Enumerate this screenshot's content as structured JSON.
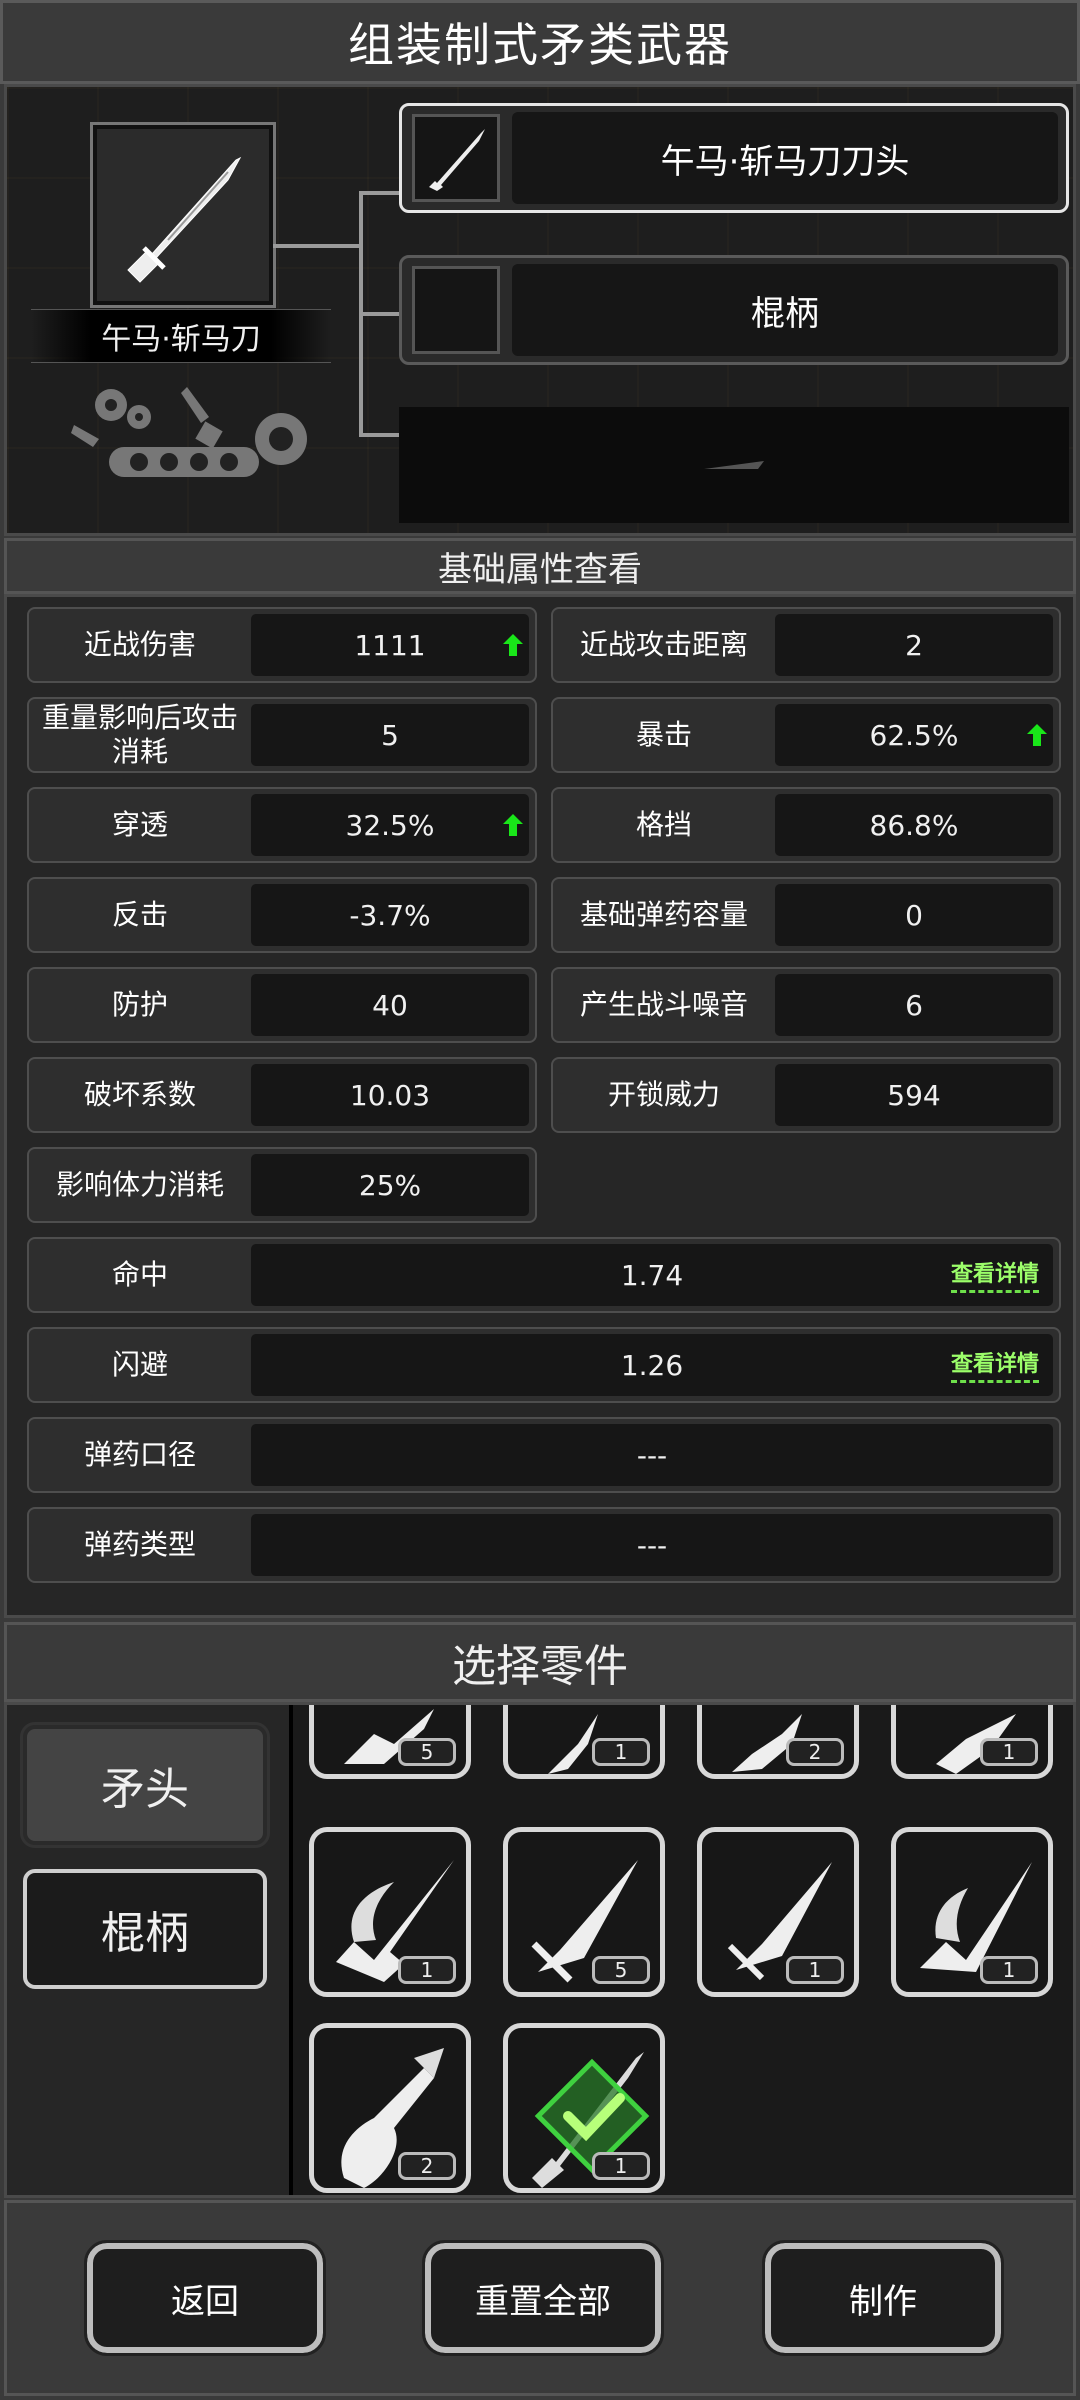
{
  "header": {
    "title": "组装制式矛类武器"
  },
  "assembly": {
    "weapon_name": "午马·斩马刀",
    "weapon_icon": "saber-icon",
    "parts": [
      {
        "label": "午马·斩马刀刀头",
        "icon": "blade-icon",
        "active": true
      },
      {
        "label": "棍柄",
        "icon": "",
        "active": false
      },
      {
        "label": "",
        "icon": "",
        "locked": true
      }
    ]
  },
  "attributes": {
    "title": "基础属性查看",
    "stats": [
      {
        "label": "近战伤害",
        "value": "1111",
        "up": true
      },
      {
        "label": "近战攻击距离",
        "value": "2",
        "up": false
      },
      {
        "label": "重量影响后攻击消耗",
        "value": "5",
        "up": false
      },
      {
        "label": "暴击",
        "value": "62.5%",
        "up": true
      },
      {
        "label": "穿透",
        "value": "32.5%",
        "up": true
      },
      {
        "label": "格挡",
        "value": "86.8%",
        "up": false
      },
      {
        "label": "反击",
        "value": "-3.7%",
        "up": false
      },
      {
        "label": "基础弹药容量",
        "value": "0",
        "up": false
      },
      {
        "label": "防护",
        "value": "40",
        "up": false
      },
      {
        "label": "产生战斗噪音",
        "value": "6",
        "up": false
      },
      {
        "label": "破坏系数",
        "value": "10.03",
        "up": false
      },
      {
        "label": "开锁威力",
        "value": "594",
        "up": false
      },
      {
        "label": "影响体力消耗",
        "value": "25%",
        "up": false
      }
    ],
    "wide_stats": [
      {
        "label": "命中",
        "value": "1.74",
        "link": "查看详情"
      },
      {
        "label": "闪避",
        "value": "1.26",
        "link": "查看详情"
      },
      {
        "label": "弹药口径",
        "value": "---",
        "link": ""
      },
      {
        "label": "弹药类型",
        "value": "---",
        "link": ""
      }
    ],
    "up_color": "#19e619",
    "link_color": "#9cff6a"
  },
  "selection": {
    "title": "选择零件",
    "categories": [
      {
        "label": "矛头",
        "active": true
      },
      {
        "label": "棍柄",
        "active": false
      }
    ],
    "items": [
      {
        "count": "5",
        "icon": "spearhead-icon"
      },
      {
        "count": "1",
        "icon": "spearhead-icon"
      },
      {
        "count": "2",
        "icon": "spearhead-icon"
      },
      {
        "count": "1",
        "icon": "spearhead-icon"
      },
      {
        "count": "1",
        "icon": "trident-head-icon"
      },
      {
        "count": "5",
        "icon": "spear-tip-icon"
      },
      {
        "count": "1",
        "icon": "spear-tip-icon"
      },
      {
        "count": "1",
        "icon": "drill-spear-icon"
      },
      {
        "count": "2",
        "icon": "claw-head-icon"
      },
      {
        "count": "1",
        "icon": "saber-head-icon",
        "selected": true
      }
    ],
    "selected_color": "#3fd13f"
  },
  "footer": {
    "back": "返回",
    "reset": "重置全部",
    "craft": "制作"
  }
}
